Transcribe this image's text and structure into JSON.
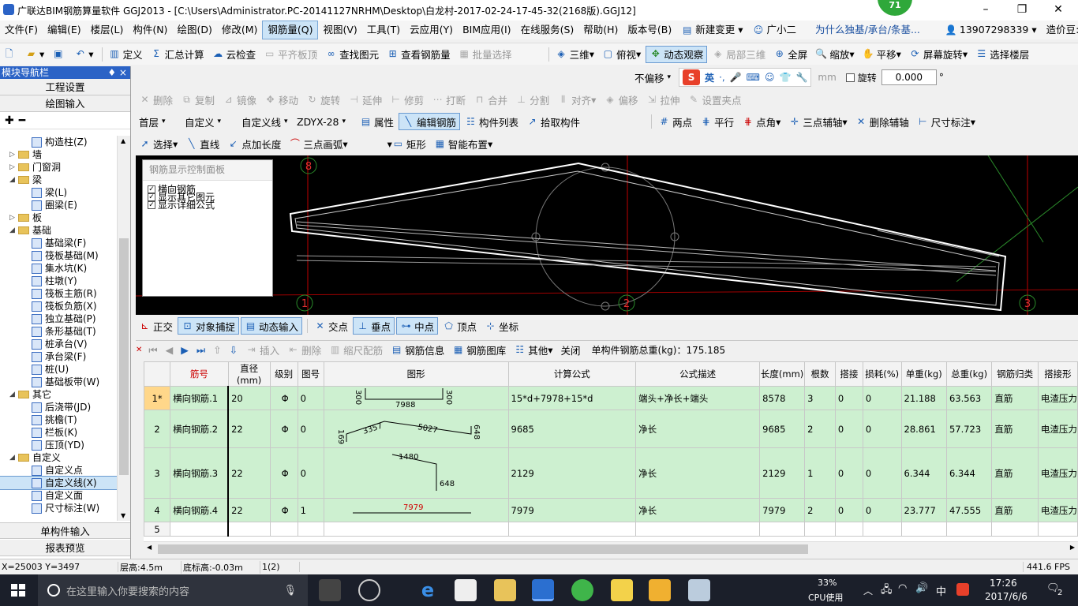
{
  "window": {
    "title": "广联达BIM钢筋算量软件 GGJ2013 - [C:\\Users\\Administrator.PC-20141127NRHM\\Desktop\\白龙村-2017-02-24-17-45-32(2168版).GGJ12]",
    "badge": "71",
    "minimize": "–",
    "restore": "❐",
    "close": "✕"
  },
  "menu": [
    "文件(F)",
    "编辑(E)",
    "楼层(L)",
    "构件(N)",
    "绘图(D)",
    "修改(M)",
    "钢筋量(Q)",
    "视图(V)",
    "工具(T)",
    "云应用(Y)",
    "BIM应用(I)",
    "在线服务(S)",
    "帮助(H)",
    "版本号(B)",
    "新建变更",
    "广小二"
  ],
  "menu_right": {
    "news": "为什么独基/承台/条基...",
    "phone": "13907298339",
    "beans": "造价豆:0"
  },
  "toolbar1": [
    "定义",
    "汇总计算",
    "云检查",
    "平齐板顶",
    "查找图元",
    "查看钢筋量",
    "批量选择",
    "三维",
    "俯视",
    "动态观察",
    "局部三维",
    "全屏",
    "缩放",
    "平移",
    "屏幕旋转",
    "选择楼层"
  ],
  "offset": {
    "mode": "不偏移",
    "unit": "mm",
    "rotate_label": "旋转",
    "rotate_value": "0.000",
    "ime": "英"
  },
  "toolbar3": [
    "删除",
    "复制",
    "镜像",
    "移动",
    "旋转",
    "延伸",
    "修剪",
    "打断",
    "合并",
    "分割",
    "对齐",
    "偏移",
    "拉伸",
    "设置夹点"
  ],
  "toolbar4": {
    "floor": "首层",
    "type": "自定义",
    "sub": "自定义线",
    "code": "ZDYX-28",
    "btns": [
      "属性",
      "编辑钢筋",
      "构件列表",
      "拾取构件"
    ],
    "right": [
      "两点",
      "平行",
      "点角",
      "三点辅轴",
      "删除辅轴",
      "尺寸标注"
    ]
  },
  "toolbar5": [
    "选择",
    "直线",
    "点加长度",
    "三点画弧",
    "矩形",
    "智能布置"
  ],
  "nav": {
    "title": "模块导航栏",
    "pin": "♦ ×",
    "sections": [
      "工程设置",
      "绘图输入"
    ],
    "bottom": [
      "单构件输入",
      "报表预览"
    ]
  },
  "tree": [
    {
      "lvl": 2,
      "label": "构造柱(Z)",
      "kind": "leaf"
    },
    {
      "lvl": 0,
      "label": "墙",
      "kind": "folder",
      "tw": "▷"
    },
    {
      "lvl": 0,
      "label": "门窗洞",
      "kind": "folder",
      "tw": "▷"
    },
    {
      "lvl": 0,
      "label": "梁",
      "kind": "folder",
      "tw": "◢"
    },
    {
      "lvl": 2,
      "label": "梁(L)",
      "kind": "leaf"
    },
    {
      "lvl": 2,
      "label": "圈梁(E)",
      "kind": "leaf"
    },
    {
      "lvl": 0,
      "label": "板",
      "kind": "folder",
      "tw": "▷"
    },
    {
      "lvl": 0,
      "label": "基础",
      "kind": "folder",
      "tw": "◢"
    },
    {
      "lvl": 2,
      "label": "基础梁(F)",
      "kind": "leaf"
    },
    {
      "lvl": 2,
      "label": "筏板基础(M)",
      "kind": "leaf"
    },
    {
      "lvl": 2,
      "label": "集水坑(K)",
      "kind": "leaf"
    },
    {
      "lvl": 2,
      "label": "柱墩(Y)",
      "kind": "leaf"
    },
    {
      "lvl": 2,
      "label": "筏板主筋(R)",
      "kind": "leaf"
    },
    {
      "lvl": 2,
      "label": "筏板负筋(X)",
      "kind": "leaf"
    },
    {
      "lvl": 2,
      "label": "独立基础(P)",
      "kind": "leaf"
    },
    {
      "lvl": 2,
      "label": "条形基础(T)",
      "kind": "leaf"
    },
    {
      "lvl": 2,
      "label": "桩承台(V)",
      "kind": "leaf"
    },
    {
      "lvl": 2,
      "label": "承台梁(F)",
      "kind": "leaf"
    },
    {
      "lvl": 2,
      "label": "桩(U)",
      "kind": "leaf"
    },
    {
      "lvl": 2,
      "label": "基础板带(W)",
      "kind": "leaf"
    },
    {
      "lvl": 0,
      "label": "其它",
      "kind": "folder",
      "tw": "◢"
    },
    {
      "lvl": 2,
      "label": "后浇带(JD)",
      "kind": "leaf"
    },
    {
      "lvl": 2,
      "label": "挑檐(T)",
      "kind": "leaf"
    },
    {
      "lvl": 2,
      "label": "栏板(K)",
      "kind": "leaf"
    },
    {
      "lvl": 2,
      "label": "压顶(YD)",
      "kind": "leaf"
    },
    {
      "lvl": 0,
      "label": "自定义",
      "kind": "folder",
      "tw": "◢"
    },
    {
      "lvl": 2,
      "label": "自定义点",
      "kind": "leaf"
    },
    {
      "lvl": 2,
      "label": "自定义线(X)",
      "kind": "leaf",
      "selected": true
    },
    {
      "lvl": 2,
      "label": "自定义面",
      "kind": "leaf"
    },
    {
      "lvl": 2,
      "label": "尺寸标注(W)",
      "kind": "leaf"
    }
  ],
  "panel": {
    "title": "钢筋显示控制面板",
    "items": [
      "横向钢筋",
      "显示其它图元",
      "显示详细公式"
    ]
  },
  "canvas": {
    "axes": [
      "8",
      "1",
      "2",
      "3"
    ]
  },
  "snapbar": [
    "正交",
    "对象捕捉",
    "动态输入",
    "交点",
    "垂点",
    "中点",
    "顶点",
    "坐标"
  ],
  "gridtoolbar": {
    "btns": [
      "插入",
      "删除",
      "缩尺配筋",
      "钢筋信息",
      "钢筋图库",
      "其他",
      "关闭"
    ],
    "total": "单构件钢筋总重(kg)：175.185"
  },
  "table": {
    "headers": [
      "筋号",
      "直径(mm)",
      "级别",
      "图号",
      "图形",
      "计算公式",
      "公式描述",
      "长度(mm)",
      "根数",
      "搭接",
      "损耗(%)",
      "单重(kg)",
      "总重(kg)",
      "钢筋归类",
      "搭接形"
    ],
    "rows": [
      {
        "no": "1*",
        "name": "横向钢筋.1",
        "dia": "20",
        "grade": "Φ",
        "fig": "0",
        "shape": [
          "300",
          "7988",
          "300"
        ],
        "formula": "15*d+7978+15*d",
        "desc": "端头+净长+端头",
        "len": "8578",
        "count": "3",
        "lap": "0",
        "loss": "0",
        "unit": "21.188",
        "total": "63.563",
        "cat": "直筋",
        "laptype": "电渣压力"
      },
      {
        "no": "2",
        "name": "横向钢筋.2",
        "dia": "22",
        "grade": "Φ",
        "fig": "0",
        "shape": [
          "169",
          "3357",
          "5027",
          "648"
        ],
        "formula": "9685",
        "desc": "净长",
        "len": "9685",
        "count": "2",
        "lap": "0",
        "loss": "0",
        "unit": "28.861",
        "total": "57.723",
        "cat": "直筋",
        "laptype": "电渣压力"
      },
      {
        "no": "3",
        "name": "横向钢筋.3",
        "dia": "22",
        "grade": "Φ",
        "fig": "0",
        "shape": [
          "1480",
          "648"
        ],
        "formula": "2129",
        "desc": "净长",
        "len": "2129",
        "count": "1",
        "lap": "0",
        "loss": "0",
        "unit": "6.344",
        "total": "6.344",
        "cat": "直筋",
        "laptype": "电渣压力"
      },
      {
        "no": "4",
        "name": "横向钢筋.4",
        "dia": "22",
        "grade": "Φ",
        "fig": "1",
        "shape": [
          "7979"
        ],
        "formula": "7979",
        "desc": "净长",
        "len": "7979",
        "count": "2",
        "lap": "0",
        "loss": "0",
        "unit": "23.777",
        "total": "47.555",
        "cat": "直筋",
        "laptype": "电渣压力"
      },
      {
        "no": "5"
      }
    ]
  },
  "status": {
    "coords": "X=25003 Y=3497",
    "floor_h": "层高:4.5m",
    "base_h": "底标高:-0.03m",
    "count": "1(2)",
    "fps": "441.6 FPS"
  },
  "taskbar": {
    "search": "在这里输入你要搜索的内容",
    "cpu_pct": "33%",
    "cpu_label": "CPU使用",
    "lang": "中",
    "time": "17:26",
    "date": "2017/6/6",
    "notif": "2"
  },
  "colors": {
    "accent": "#2b63c6",
    "grid_green": "#cdf0d0",
    "row_sel": "#ffd78a",
    "cad_red": "#c00000",
    "cad_green": "#2a8a2a"
  }
}
